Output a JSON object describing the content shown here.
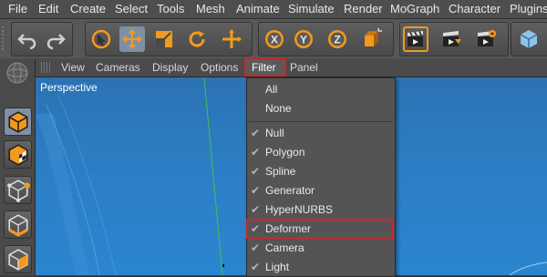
{
  "main_menu": [
    "File",
    "Edit",
    "Create",
    "Select",
    "Tools",
    "Mesh",
    "Animate",
    "Simulate",
    "Render",
    "MoGraph",
    "Character",
    "Plugins"
  ],
  "view_menu": {
    "items": [
      "View",
      "Cameras",
      "Display",
      "Options",
      "Filter",
      "Panel"
    ],
    "active": "Filter"
  },
  "viewport": {
    "label": "Perspective"
  },
  "filter_menu": {
    "top_items": [
      "All",
      "None"
    ],
    "items": [
      {
        "label": "Null",
        "checked": true
      },
      {
        "label": "Polygon",
        "checked": true
      },
      {
        "label": "Spline",
        "checked": true
      },
      {
        "label": "Generator",
        "checked": true
      },
      {
        "label": "HyperNURBS",
        "checked": true
      },
      {
        "label": "Deformer",
        "checked": true
      },
      {
        "label": "Camera",
        "checked": true
      },
      {
        "label": "Light",
        "checked": true
      }
    ],
    "check_glyph": "✔",
    "highlighted": "Deformer"
  },
  "toolbar_icons": [
    "undo-icon",
    "redo-icon",
    "live-selection-icon",
    "move-icon",
    "scale-icon",
    "rotate-icon",
    "add-icon",
    "x-axis-icon",
    "y-axis-icon",
    "z-axis-icon",
    "coordinate-system-icon",
    "render-view-icon",
    "render-picture-viewer-icon",
    "render-settings-icon",
    "cube-icon"
  ],
  "colors": {
    "accent_highlight": "#d0232a",
    "viewport_blue": "#2c7ec4",
    "selected_tool": "#7f8fa6",
    "orange": "#f39a1c"
  }
}
